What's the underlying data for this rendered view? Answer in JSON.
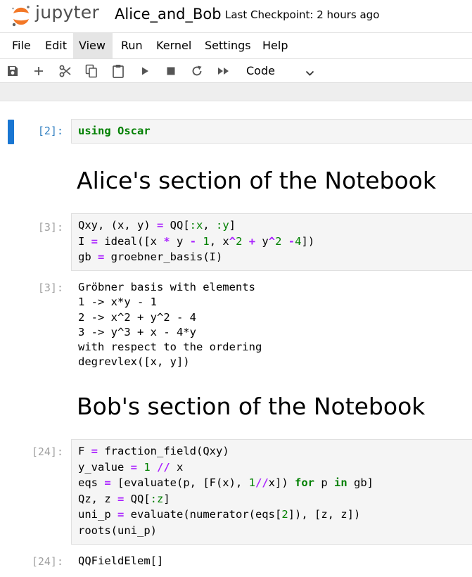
{
  "header": {
    "logo_text": "jupyter",
    "notebook_title": "Alice_and_Bob",
    "checkpoint": "Last Checkpoint: 2 hours ago"
  },
  "menu": [
    "File",
    "Edit",
    "View",
    "Run",
    "Kernel",
    "Settings",
    "Help"
  ],
  "active_menu": "View",
  "toolbar": {
    "icons": [
      "save-icon",
      "add-icon",
      "cut-icon",
      "copy-icon",
      "paste-icon",
      "run-icon",
      "stop-icon",
      "restart-icon",
      "fast-forward-icon"
    ],
    "cell_type": "Code"
  },
  "cells": {
    "c1": {
      "prompt": "[2]:",
      "code": [
        "using Oscar"
      ]
    },
    "h1": "Alice's section of the Notebook",
    "c2": {
      "prompt": "[3]:",
      "code": [
        "Qxy, (x, y) = QQ[:x, :y]",
        "I = ideal([x * y - 1, x^2 + y^2 -4])",
        "gb = groebner_basis(I)"
      ],
      "out_prompt": "[3]:",
      "output": [
        "Gröbner basis with elements",
        "1 -> x*y - 1",
        "2 -> x^2 + y^2 - 4",
        "3 -> y^3 + x - 4*y",
        "with respect to the ordering",
        "degrevlex([x, y])"
      ]
    },
    "h2": "Bob's section of the Notebook",
    "c3": {
      "prompt": "[24]:",
      "code": [
        "F = fraction_field(Qxy)",
        "y_value = 1 // x",
        "eqs = [evaluate(p, [F(x), 1//x]) for p in gb]",
        "Qz, z = QQ[:z]",
        "uni_p = evaluate(numerator(eqs[2]), [z, z])",
        "roots(uni_p)"
      ],
      "out_prompt": "[24]:",
      "output": [
        "QQFieldElem[]"
      ]
    }
  },
  "colors": {
    "accent": "#1976d2",
    "keyword": "#008000",
    "operator": "#aa22ff",
    "logo_orange": "#f37726"
  }
}
